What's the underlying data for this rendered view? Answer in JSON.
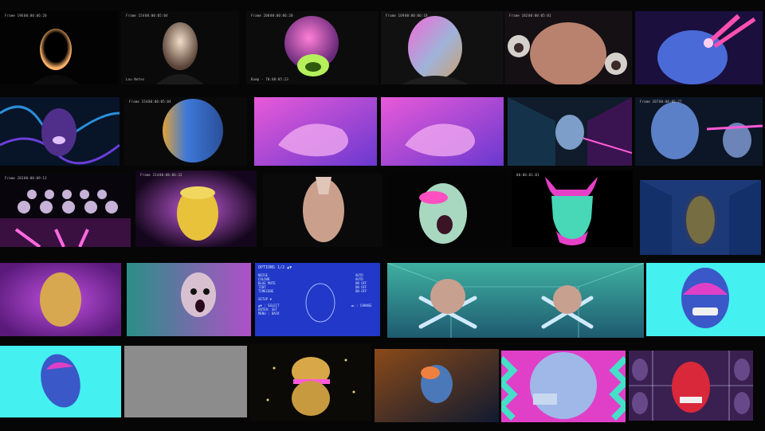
{
  "frames": [
    {
      "hud": [
        "Frame 196",
        "00:00:06:20"
      ]
    },
    {
      "hud": [
        "Frame 154",
        "00:00:05:04",
        "Lou Notes"
      ]
    },
    {
      "hud": [
        "Frame 208",
        "00:00:06:20",
        "Bump - 70:00:05:23"
      ]
    },
    {
      "hud": [
        "Frame 169",
        "00:00:06:18"
      ]
    },
    {
      "hud": [
        "Frame 182",
        "00:00:05:01"
      ]
    },
    {
      "hud": []
    },
    {
      "hud": []
    },
    {
      "hud": [
        "Frame 154",
        "00:00:05:04"
      ]
    },
    {
      "hud": []
    },
    {
      "hud": []
    },
    {
      "hud": [
        "Frame 207",
        "00:00:06:27"
      ]
    },
    {
      "hud": [
        "Frame 283",
        "00:00:09:13"
      ]
    },
    {
      "hud": [
        "Frame 214",
        "00:00:06:32"
      ]
    },
    {
      "hud": []
    },
    {
      "hud": []
    },
    {
      "hud": []
    },
    {
      "hud": [
        "00:00:01:01"
      ]
    },
    {
      "hud": []
    },
    {
      "hud": []
    },
    {
      "hud": []
    },
    {
      "hud": []
    },
    {
      "hud": []
    },
    {
      "hud": []
    },
    {
      "hud": []
    },
    {
      "hud": []
    },
    {
      "hud": []
    },
    {
      "hud": []
    },
    {
      "hud": []
    },
    {
      "hud": []
    }
  ],
  "options_menu": {
    "title": "OPTIONS 1/2 ▲▼",
    "items": [
      "NOISE",
      "COLOUR",
      "BLUE MUTE",
      "TINT",
      "TIMECODE"
    ],
    "values": [
      "AUTO",
      "AUTO",
      "ON OFF",
      "ON OFF",
      "ON OFF"
    ],
    "setup": "SETUP ▼",
    "nav": [
      "▲▼ : SELECT",
      "ENTER: SET",
      "MENU : BACK"
    ],
    "change": "◄► : CHANGE"
  },
  "colors": {
    "background": "#060607",
    "magenta": "#e040c8",
    "cyan": "#45f0f0",
    "purple": "#7a2fd0",
    "blue_ui": "#2a3cd8",
    "teal": "#2f8f86"
  }
}
